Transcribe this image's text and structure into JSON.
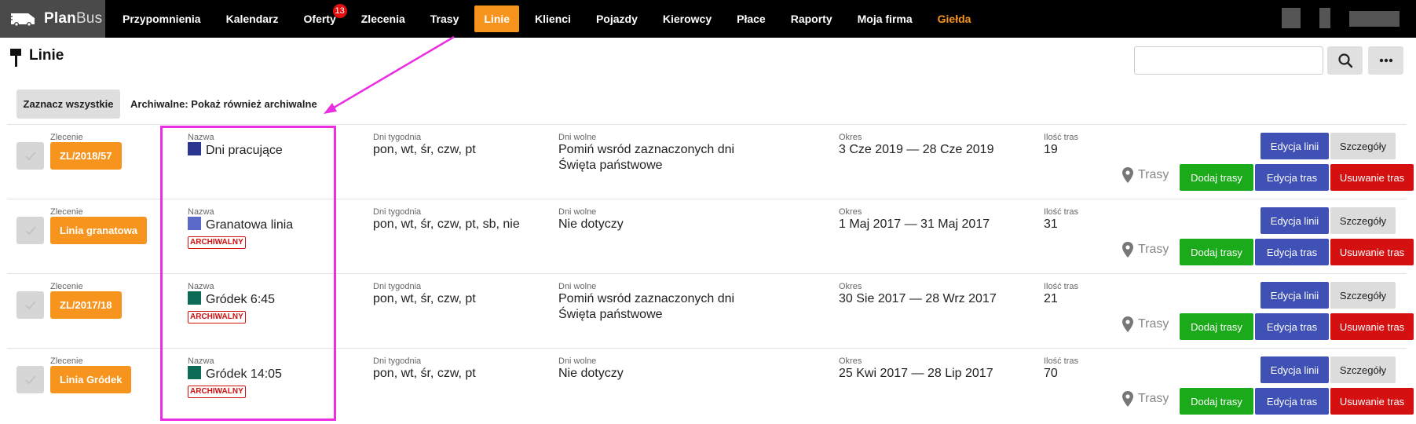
{
  "app": {
    "logo_bold": "Plan",
    "logo_thin": "Bus"
  },
  "nav": {
    "items": [
      {
        "label": "Przypomnienia"
      },
      {
        "label": "Kalendarz"
      },
      {
        "label": "Oferty",
        "badge": "13"
      },
      {
        "label": "Zlecenia"
      },
      {
        "label": "Trasy"
      },
      {
        "label": "Linie",
        "active": true
      },
      {
        "label": "Klienci"
      },
      {
        "label": "Pojazdy"
      },
      {
        "label": "Kierowcy"
      },
      {
        "label": "Płace"
      },
      {
        "label": "Raporty"
      },
      {
        "label": "Moja firma"
      },
      {
        "label": "Giełda",
        "accent": true
      }
    ]
  },
  "page": {
    "title": "Linie",
    "search_value": "",
    "select_all_label": "Zaznacz wszystkie",
    "archive_filter": "Archiwalne: Pokaż również archiwalne"
  },
  "labels": {
    "order": "Zlecenie",
    "name": "Nazwa",
    "weekdays": "Dni tygodnia",
    "days_off": "Dni wolne",
    "period": "Okres",
    "route_count": "Ilość tras",
    "routes": "Trasy",
    "archived": "ARCHIWALNY",
    "edit_line": "Edycja linii",
    "details": "Szczegóły",
    "add_routes": "Dodaj trasy",
    "edit_routes": "Edycja tras",
    "delete_routes": "Usuwanie tras"
  },
  "rows": [
    {
      "order": "ZL/2018/57",
      "name": "Dni pracujące",
      "color": "#2a3590",
      "archived": false,
      "weekdays": "pon, wt, śr, czw, pt",
      "days_off_1": "Pomiń wsród zaznaczonych dni",
      "days_off_2": "Święta państwowe",
      "period": "3 Cze 2019 — 28 Cze 2019",
      "route_count": "19"
    },
    {
      "order": "Linia granatowa",
      "name": "Granatowa linia",
      "color": "#5b6ac8",
      "archived": true,
      "weekdays": "pon, wt, śr, czw, pt, sb, nie",
      "days_off_1": "Nie dotyczy",
      "days_off_2": "",
      "period": "1 Maj 2017 — 31 Maj 2017",
      "route_count": "31"
    },
    {
      "order": "ZL/2017/18",
      "name": "Gródek 6:45",
      "color": "#0e6b55",
      "archived": true,
      "weekdays": "pon, wt, śr, czw, pt",
      "days_off_1": "Pomiń wsród zaznaczonych dni",
      "days_off_2": "Święta państwowe",
      "period": "30 Sie 2017 — 28 Wrz 2017",
      "route_count": "21"
    },
    {
      "order": "Linia Gródek",
      "name": "Gródek 14:05",
      "color": "#0e6b55",
      "archived": true,
      "weekdays": "pon, wt, śr, czw, pt",
      "days_off_1": "Nie dotyczy",
      "days_off_2": "",
      "period": "25 Kwi 2017 — 28 Lip 2017",
      "route_count": "70"
    }
  ],
  "colors": {
    "accent": "#f7941d",
    "primary": "#3f51b5",
    "success": "#1aaa1a",
    "danger": "#d41010",
    "annotation": "#ea2ee0"
  }
}
